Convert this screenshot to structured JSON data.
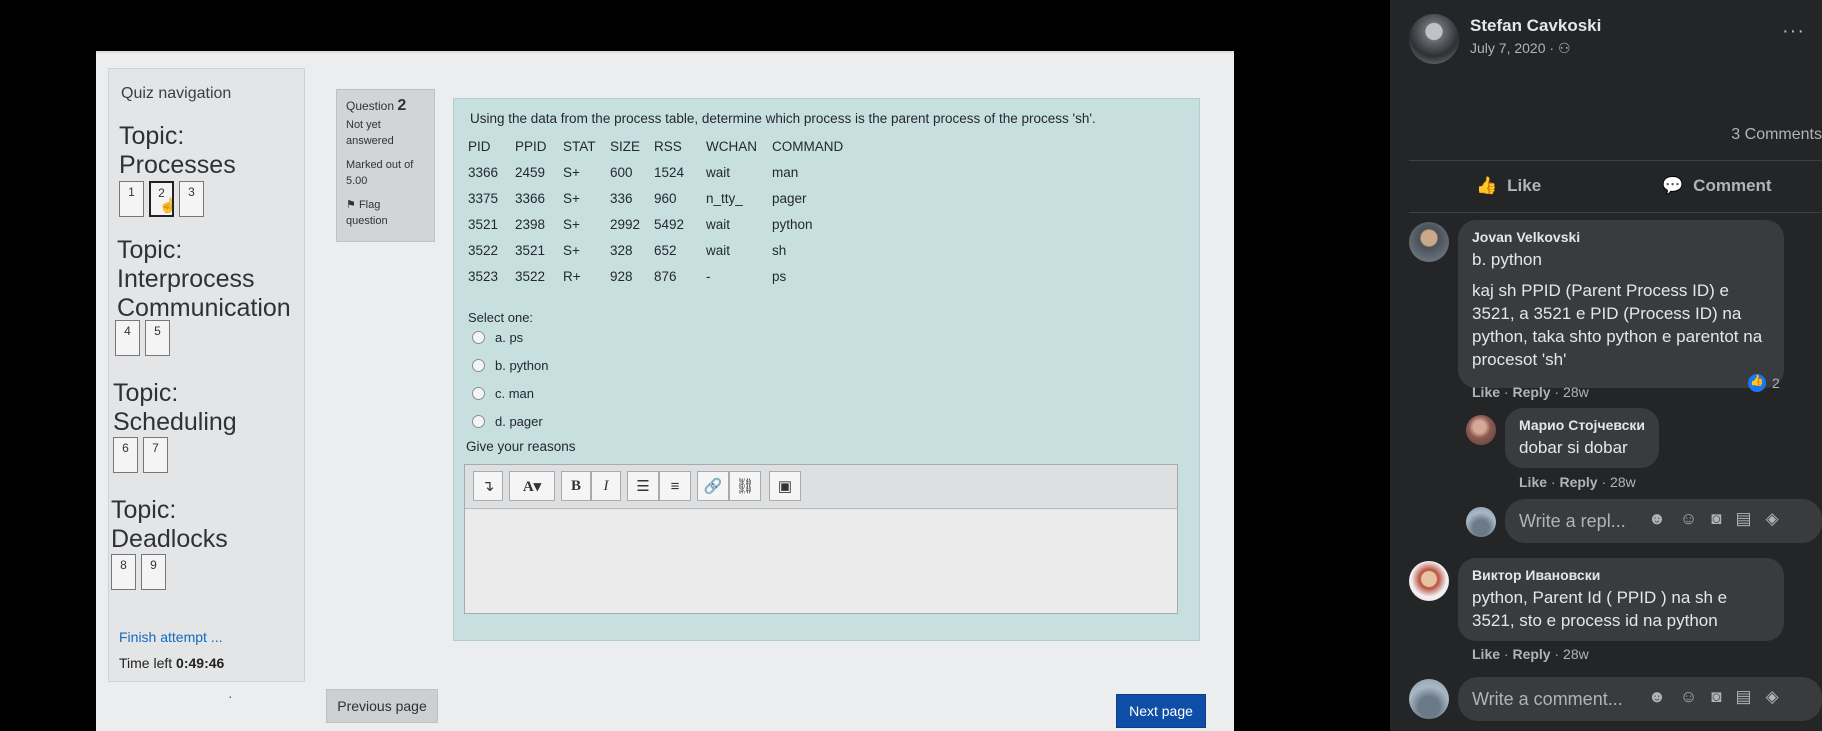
{
  "quiz": {
    "nav_title": "Quiz navigation",
    "topics": [
      {
        "label_line1": "Topic:",
        "label_line2": "Processes",
        "label_line3": "",
        "questions": [
          "1",
          "2",
          "3"
        ]
      },
      {
        "label_line1": "Topic:",
        "label_line2": "Interprocess",
        "label_line3": "Communication",
        "questions": [
          "4",
          "5"
        ]
      },
      {
        "label_line1": "Topic:",
        "label_line2": "Scheduling",
        "label_line3": "",
        "questions": [
          "6",
          "7"
        ]
      },
      {
        "label_line1": "Topic:",
        "label_line2": "Deadlocks",
        "label_line3": "",
        "questions": [
          "8",
          "9"
        ]
      }
    ],
    "finish_label": "Finish attempt ...",
    "time_left_label": "Time left",
    "time_left_value": "0:49:46",
    "question_label": "Question",
    "question_number": "2",
    "status_line1": "Not yet",
    "status_line2": "answered",
    "marked_line1": "Marked out of",
    "marked_line2": "5.00",
    "flag_line1": "Flag",
    "flag_line2": "question",
    "question_text": "Using the data from the process table, determine which process is the parent process of the process 'sh'.",
    "table_headers": [
      "PID",
      "PPID",
      "STAT",
      "SIZE",
      "RSS",
      "WCHAN",
      "COMMAND"
    ],
    "table_rows": [
      [
        "3366",
        "2459",
        "S+",
        "600",
        "1524",
        "wait",
        "man"
      ],
      [
        "3375",
        "3366",
        "S+",
        "336",
        "960",
        "n_tty_",
        "pager"
      ],
      [
        "3521",
        "2398",
        "S+",
        "2992",
        "5492",
        "wait",
        "python"
      ],
      [
        "3522",
        "3521",
        "S+",
        "328",
        "652",
        "wait",
        "sh"
      ],
      [
        "3523",
        "3522",
        "R+",
        "928",
        "876",
        "-",
        "ps"
      ]
    ],
    "select_one": "Select one:",
    "options": [
      "a. ps",
      "b. python",
      "c. man",
      "d. pager"
    ],
    "give_reasons": "Give your reasons",
    "prev_label": "Previous page",
    "next_label": "Next page",
    "accent": "#0f4ea7"
  },
  "post": {
    "author": "Stefan Cavkoski",
    "date": "July 7, 2020 ·",
    "more": "···",
    "comments_count": "3 Comments",
    "like_action": "Like",
    "comment_action": "Comment",
    "comments": [
      {
        "name": "Jovan Velkovski",
        "line1": "b. python",
        "line2": "kaj sh PPID (Parent Process ID) e 3521, a 3521 e PID (Process ID) na python, taka shto python e parentot na procesot 'sh'",
        "like": "Like",
        "reply": "Reply",
        "age": "28w",
        "reactions": "2"
      },
      {
        "name": "Марио Стојчевски",
        "line1": "dobar si dobar",
        "like": "Like",
        "reply": "Reply",
        "age": "28w"
      },
      {
        "name": "Виктор Ивановски",
        "line1": "python, Parent Id ( PPID ) na sh e 3521, sto e process id na python",
        "like": "Like",
        "reply": "Reply",
        "age": "28w"
      }
    ],
    "reply_placeholder": "Write a repl...",
    "comment_placeholder": "Write a comment...",
    "fb_bg": "#242526",
    "bubble_bg": "#3a3b3c"
  }
}
